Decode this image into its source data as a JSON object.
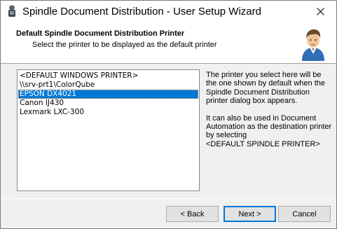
{
  "window": {
    "title": "Spindle Document Distribution - User Setup Wizard"
  },
  "header": {
    "title": "Default Spindle Document Distribution Printer",
    "subtitle": "Select the printer to be displayed as the default printer"
  },
  "printer_list": {
    "items": [
      {
        "label": "<DEFAULT WINDOWS PRINTER>",
        "selected": false
      },
      {
        "label": "\\\\srv-prt1\\ColorQube",
        "selected": false
      },
      {
        "label": "EPSON DX4021",
        "selected": true
      },
      {
        "label": "Canon IJ430",
        "selected": false
      },
      {
        "label": "Lexmark LXC-300",
        "selected": false
      }
    ]
  },
  "description": {
    "paragraph1": "The printer you select here will be the one shown by default when the Spindle Document Distribution printer dialog box appears.",
    "paragraph2_line1": "It can also be used in Document Automation as the destination printer by selecting",
    "paragraph2_line2": "<DEFAULT SPINDLE PRINTER>"
  },
  "buttons": {
    "back": "< Back",
    "next": "Next >",
    "cancel": "Cancel"
  },
  "colors": {
    "selection": "#0078d7",
    "dialog_bg": "#f0f0f0",
    "header_bg": "#ffffff"
  }
}
